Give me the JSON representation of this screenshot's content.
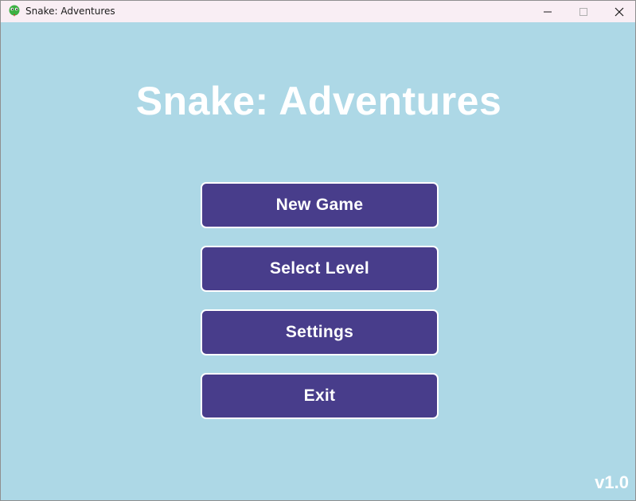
{
  "window": {
    "title": "Snake: Adventures",
    "icon": "snake-icon",
    "controls": {
      "minimize_icon": "minimize-icon",
      "maximize_icon": "maximize-icon",
      "close_icon": "close-icon"
    }
  },
  "main_menu": {
    "title": "Snake: Adventures",
    "buttons": [
      {
        "label": "New Game"
      },
      {
        "label": "Select Level"
      },
      {
        "label": "Settings"
      },
      {
        "label": "Exit"
      }
    ],
    "version": "v1.0"
  },
  "colors": {
    "background": "#add8e6",
    "button_fill": "#483d8b",
    "button_border": "#ffffff",
    "text": "#ffffff",
    "titlebar": "#f9eef4"
  }
}
